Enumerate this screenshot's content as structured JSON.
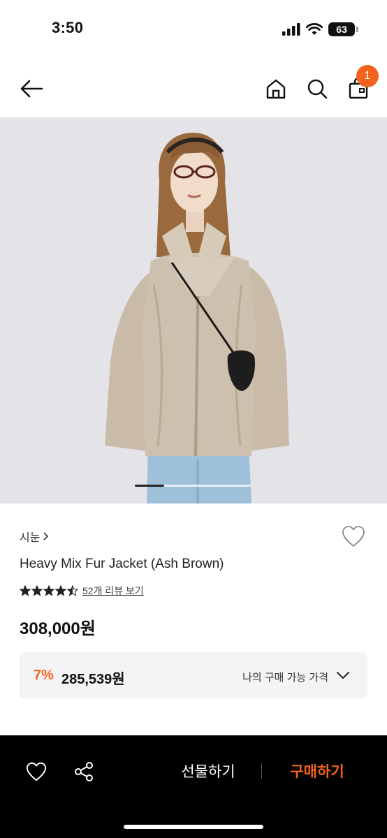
{
  "status_bar": {
    "time": "3:50",
    "battery_level": "63"
  },
  "header": {
    "cart_count": "1"
  },
  "gallery": {
    "active_slide": 1,
    "total_slides": 4
  },
  "product": {
    "brand": "시눈",
    "name": "Heavy Mix Fur Jacket (Ash Brown)",
    "rating": 4.5,
    "reviews_label": "52개 리뷰 보기",
    "price": "308,000원"
  },
  "discount": {
    "rate": "7%",
    "price": "285,539원",
    "label": "나의 구매 가능 가격"
  },
  "actions": {
    "gift_label": "선물하기",
    "buy_label": "구매하기"
  },
  "colors": {
    "accent": "#f4631e",
    "action_bar": "#000000",
    "discount_bg": "#f4f4f6"
  },
  "icons": {
    "back": "arrow-left-icon",
    "home": "home-icon",
    "search": "search-icon",
    "bag": "shopping-bag-icon",
    "wish": "heart-outline-icon",
    "like": "heart-outline-icon",
    "share": "share-icon",
    "chevron": "chevron-down-icon"
  }
}
